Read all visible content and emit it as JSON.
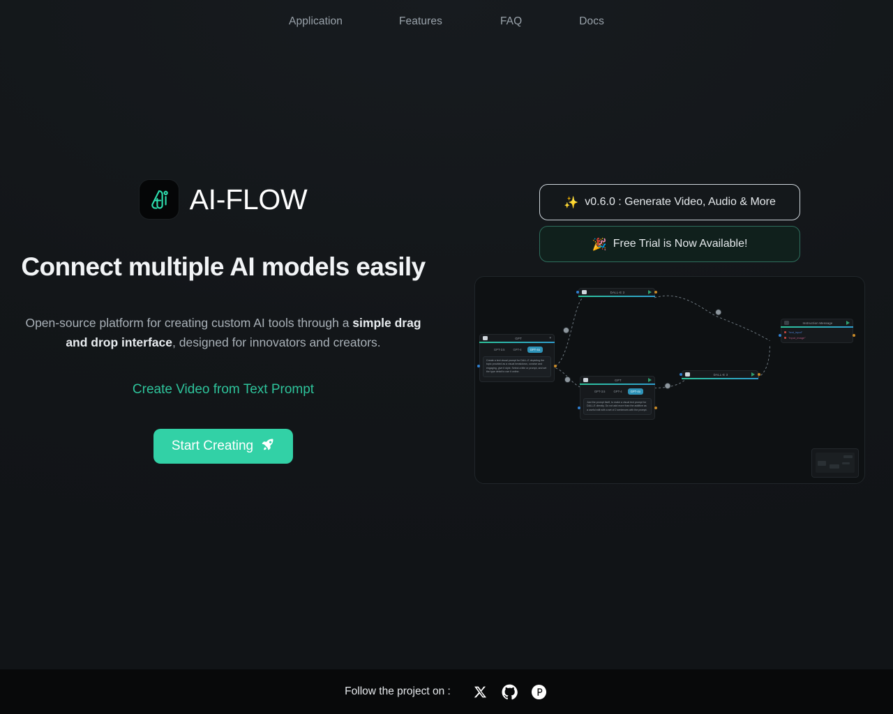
{
  "nav": {
    "items": [
      {
        "label": "Application"
      },
      {
        "label": "Features"
      },
      {
        "label": "FAQ"
      },
      {
        "label": "Docs"
      }
    ]
  },
  "hero": {
    "brand_name": "AI-FLOW",
    "logo_icon": "ai-flow-monogram-icon",
    "headline": "Connect multiple AI models easily",
    "subtitle_part1": "Open-source platform for creating custom AI tools through a ",
    "subtitle_bold": "simple drag and drop interface",
    "subtitle_part2": ", designed for innovators and creators.",
    "video_link": "Create Video from Text Prompt",
    "cta_label": "Start Creating",
    "cta_icon": "rocket-icon",
    "cta_color": "#32d1a6"
  },
  "badges": [
    {
      "emoji": "✨",
      "icon_name": "sparkles-icon",
      "label": "v0.6.0 : Generate Video, Audio & More",
      "border_color": "#cfd6dc"
    },
    {
      "emoji": "🎉",
      "icon_name": "party-popper-icon",
      "label": "Free Trial is Now Available!",
      "border_color": "#2e6e5d"
    }
  ],
  "flow": {
    "nodes": [
      {
        "id": "gpt-left",
        "title": "GPT",
        "chips": [
          "GPT-3.5",
          "GPT-4",
          "GPT-4o"
        ],
        "active_chip": "GPT-4o",
        "prompt": "Create a text visual prompt for DALL-E depicting the topic provided as a visual breakdown, concise and engaging, give it style. Select a title or prompt, and set the type detail to use it online."
      },
      {
        "id": "gpt-bottom",
        "title": "GPT",
        "chips": [
          "GPT-3.5",
          "GPT-4",
          "GPT-4o"
        ],
        "active_chip": "GPT-4o",
        "prompt": "Just the prompt itself, to make a visual text prompt for DALL-E directly. Do not add more than the additive as a useful edit with a set of 2 sentences with the prompt."
      },
      {
        "id": "dalle-top",
        "title": "DALL-E 3"
      },
      {
        "id": "dalle-mid",
        "title": "DALL-E 3"
      },
      {
        "id": "merge-right",
        "title": "Instruction Message",
        "items": [
          "\"text_input\"",
          "\"input_image\""
        ]
      }
    ],
    "minimap_label": "minimap"
  },
  "footer": {
    "text": "Follow the project on :",
    "socials": [
      {
        "name": "x-twitter-icon",
        "glyph": "X"
      },
      {
        "name": "github-icon",
        "glyph": "GH"
      },
      {
        "name": "product-hunt-icon",
        "glyph": "P"
      }
    ]
  }
}
